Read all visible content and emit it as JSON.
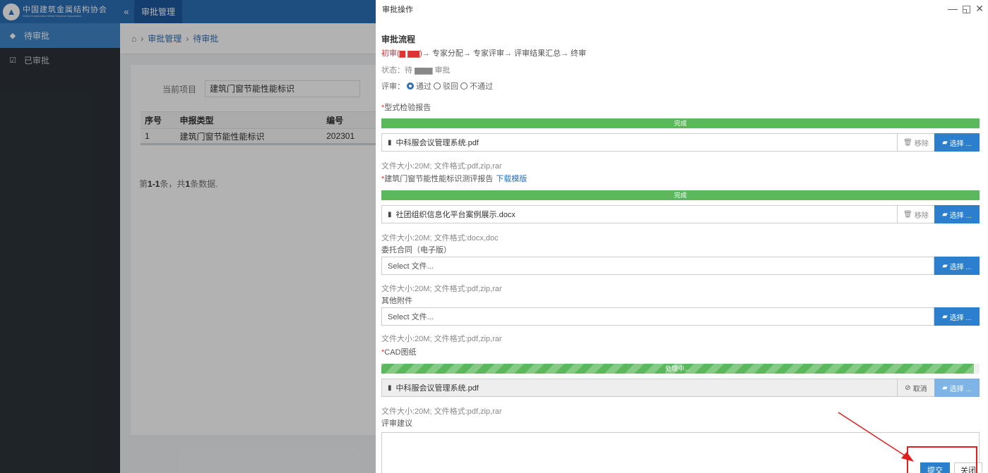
{
  "app": {
    "logo_text": "中国建筑金属结构协会",
    "logo_sub": "China Construction Metal Structure Association",
    "collapse_icon": "«",
    "top_nav": "审批管理"
  },
  "sidebar": {
    "items": [
      {
        "label": "待审批",
        "icon": "tag-icon",
        "active": true
      },
      {
        "label": "已审批",
        "icon": "check-square-icon",
        "active": false
      }
    ]
  },
  "breadcrumb": {
    "home_icon": "home-icon",
    "items": [
      "审批管理",
      "待审批"
    ]
  },
  "main": {
    "project_label": "当前项目",
    "project_value": "建筑门窗节能性能标识",
    "table": {
      "headers": [
        "序号",
        "申报类型",
        "编号"
      ],
      "rows": [
        [
          "1",
          "建筑门窗节能性能标识",
          "202301"
        ]
      ]
    },
    "pager_prefix": "第",
    "pager_range": "1-1",
    "pager_mid": "条，共",
    "pager_total": "1",
    "pager_suffix": "条数据."
  },
  "modal": {
    "title": "审批操作",
    "controls": [
      "—",
      "◱",
      "✕"
    ],
    "section_title": "审批流程",
    "flow_current": "初审(",
    "flow_current_end": ")",
    "flow_rest": "→ 专家分配→ 专家评审→ 评审结果汇总→ 终审",
    "status_text": "状态：待",
    "status_suffix": "审批",
    "review_label": "评审：",
    "review_options": [
      {
        "label": "通过",
        "checked": true
      },
      {
        "label": "驳回",
        "checked": false
      },
      {
        "label": "不通过",
        "checked": false
      }
    ],
    "fields": [
      {
        "label": "型式检验报告",
        "required": true,
        "template_link": "",
        "progress": 100,
        "progress_text": "完成",
        "file": "中科服会议管理系统.pdf",
        "action": "移除",
        "hint": "文件大小:20M;  文件格式:pdf,zip,rar"
      },
      {
        "label": "建筑门窗节能性能标识测评报告",
        "required": true,
        "template_link": "下载模版",
        "progress": 100,
        "progress_text": "完成",
        "file": "社团组织信息化平台案例展示.docx",
        "action": "移除",
        "hint": "文件大小:20M;  文件格式:docx,doc"
      },
      {
        "label": "委托合同（电子版）",
        "required": false,
        "template_link": "",
        "progress": null,
        "progress_text": "",
        "file": "Select 文件...",
        "action": "",
        "hint": "文件大小:20M;  文件格式:pdf,zip,rar"
      },
      {
        "label": "其他附件",
        "required": false,
        "template_link": "",
        "progress": null,
        "progress_text": "",
        "file": "Select 文件...",
        "action": "",
        "hint": "文件大小:20M;  文件格式:pdf,zip,rar"
      },
      {
        "label": "CAD图纸",
        "required": true,
        "template_link": "",
        "progress": 99,
        "progress_text": "处理中...",
        "file": "中科服会议管理系统.pdf",
        "action": "取消",
        "hint": "文件大小:20M;  文件格式:pdf,zip,rar"
      }
    ],
    "pick_label": "选择 ...",
    "comment_label": "评审建议",
    "submit_label": "提交",
    "close_label": "关闭",
    "colors": {
      "accent": "#2c7fcc",
      "success": "#5cb85c",
      "required": "#d33333",
      "annotation": "#e02020"
    }
  }
}
